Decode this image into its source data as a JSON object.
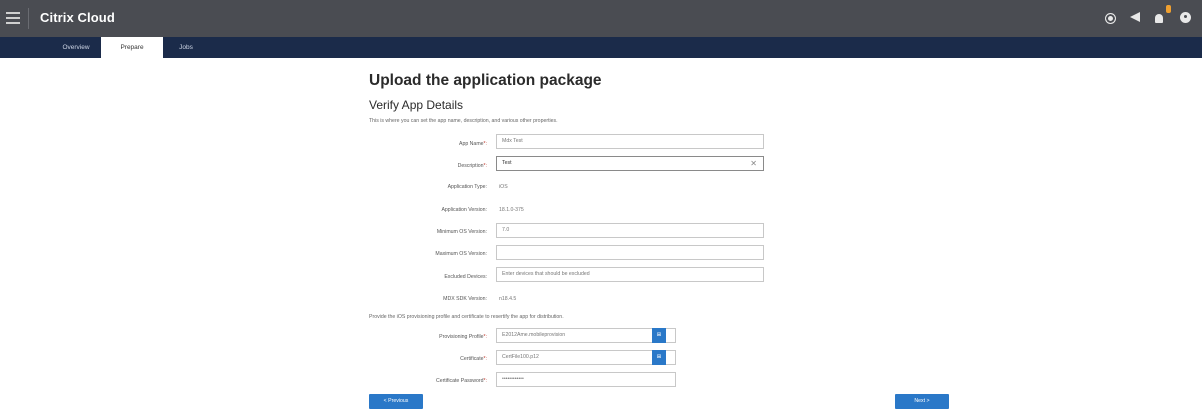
{
  "header": {
    "app_title": "Citrix Cloud",
    "icons": [
      "gear-icon",
      "megaphone-icon",
      "notification-icon",
      "help-icon"
    ],
    "notification_color": "#f0a030"
  },
  "tabs": [
    {
      "label": "Overview",
      "active": false
    },
    {
      "label": "Prepare",
      "active": true
    },
    {
      "label": "Jobs",
      "active": false
    }
  ],
  "page": {
    "title": "Upload the application package",
    "section_title": "Verify App Details",
    "description": "This is where you can set the app name, description, and various other properties.",
    "provision_note": "Provide the iOS provisioning profile and certificate to resertify the app for distribution."
  },
  "form": {
    "app_name": {
      "label": "App Name",
      "required": "*:",
      "value": "Mdx Test"
    },
    "description": {
      "label": "Description",
      "required": "*:",
      "value": "Test"
    },
    "application_type": {
      "label": "Application Type:",
      "value": "iOS"
    },
    "application_version": {
      "label": "Application Version:",
      "value": "18.1.0-375"
    },
    "min_os": {
      "label": "Minimum OS Version:",
      "value": "7.0"
    },
    "max_os": {
      "label": "Maximum OS Version:",
      "value": ""
    },
    "excluded_devices": {
      "label": "Excluded Devices:",
      "placeholder": "Enter devices that should be excluded"
    },
    "mdx_sdk": {
      "label": "MDX SDK Version:",
      "value": "n18.4.5"
    },
    "provisioning_profile": {
      "label": "Provisioning Profile",
      "required": "*:",
      "value": "E2012Ame.mobileprovision",
      "upload_label": "⊞"
    },
    "certificate": {
      "label": "Certificate",
      "required": "*:",
      "value": "CertFile100.p12",
      "upload_label": "⊞"
    },
    "certificate_password": {
      "label": "Certificate Password",
      "required": "*:",
      "value": "••••••••••••"
    }
  },
  "buttons": {
    "previous": "< Previous",
    "next": "Next >"
  },
  "colors": {
    "topbar": "#4a4c52",
    "tabbar": "#1b2b4a",
    "primary": "#2a78c8"
  }
}
